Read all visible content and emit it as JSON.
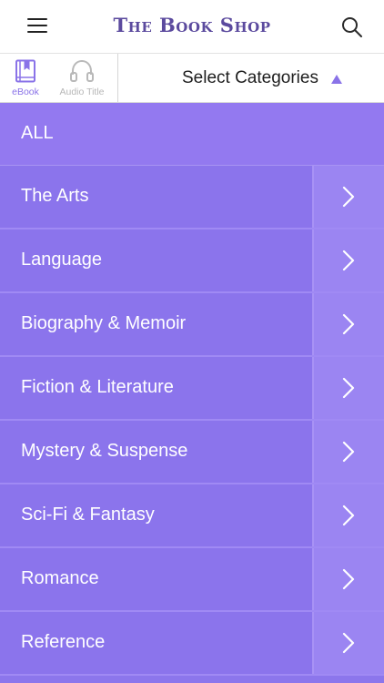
{
  "header": {
    "title": "The Book Shop",
    "menu_icon": "hamburger-menu-icon",
    "search_icon": "search-icon"
  },
  "media_tabs": [
    {
      "label": "eBook",
      "icon": "book-icon",
      "active": true
    },
    {
      "label": "Audio Title",
      "icon": "headphones-icon",
      "active": false
    }
  ],
  "category_select": {
    "label": "Select Categories",
    "caret_icon": "triangle-up-icon"
  },
  "all_row": {
    "label": "ALL"
  },
  "categories": [
    {
      "label": "The Arts"
    },
    {
      "label": "Language"
    },
    {
      "label": "Biography & Memoir"
    },
    {
      "label": "Fiction & Literature"
    },
    {
      "label": "Mystery & Suspense"
    },
    {
      "label": "Sci-Fi & Fantasy"
    },
    {
      "label": "Romance"
    },
    {
      "label": "Reference"
    }
  ],
  "colors": {
    "accent": "#8a73e8",
    "brand_text": "#5b4a9e",
    "list_background": "#8b74ec",
    "arrow_cell": "#9b85f2"
  }
}
